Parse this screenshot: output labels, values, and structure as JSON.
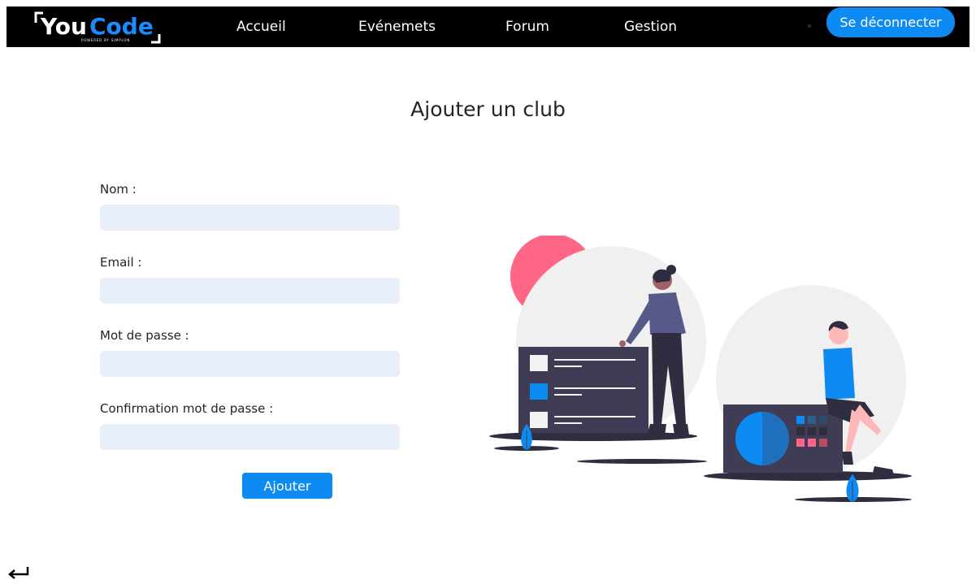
{
  "brand": {
    "logo_text": "YouCode",
    "logo_tagline": "POWERED BY SIMPLON",
    "colors": {
      "nav_bg": "#000000",
      "accent": "#0d8bf2",
      "input_bg": "#e8eef7",
      "logo_blue": "#1a8cff"
    }
  },
  "nav": {
    "links": [
      "Accueil",
      "Evénemets",
      "Forum",
      "Gestion"
    ],
    "logout_label": "Se déconnecter"
  },
  "page": {
    "title": "Ajouter un club"
  },
  "form": {
    "fields": [
      {
        "label": "Nom :",
        "value": ""
      },
      {
        "label": "Email :",
        "value": ""
      },
      {
        "label": "Mot de passe :",
        "value": ""
      },
      {
        "label": "Confirmation mot de passe :",
        "value": ""
      }
    ],
    "submit_label": "Ajouter"
  },
  "footer": {
    "back_icon": "return-arrow-icon"
  }
}
